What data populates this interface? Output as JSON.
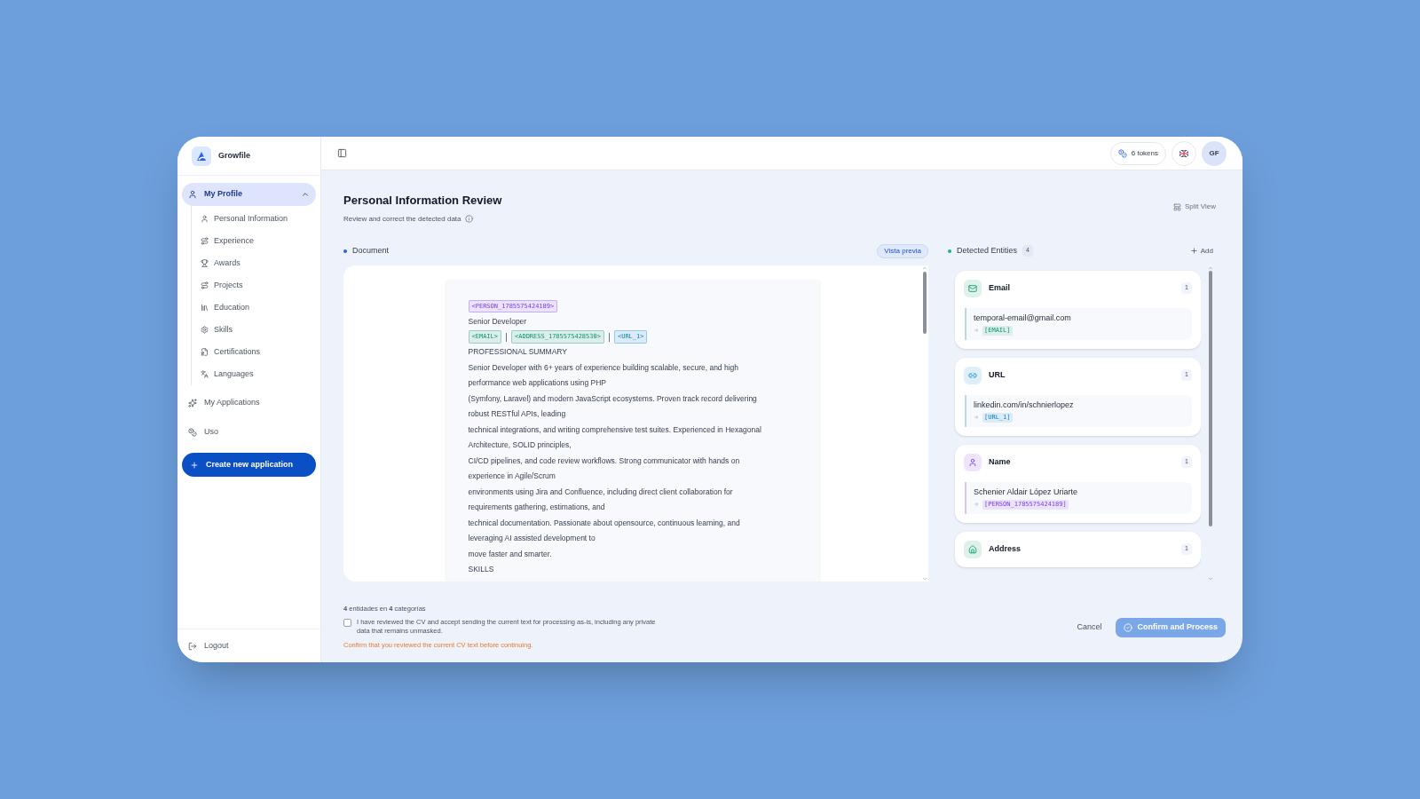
{
  "brand": {
    "name": "Growfile"
  },
  "sidebar": {
    "items": [
      {
        "label": "My Profile",
        "selected": true,
        "expanded": true,
        "children": [
          {
            "label": "Personal Information"
          },
          {
            "label": "Experience"
          },
          {
            "label": "Awards"
          },
          {
            "label": "Projects"
          },
          {
            "label": "Education"
          },
          {
            "label": "Skills"
          },
          {
            "label": "Certifications"
          },
          {
            "label": "Languages"
          }
        ]
      },
      {
        "label": "My Applications",
        "selected": false
      },
      {
        "label": "Uso",
        "selected": false
      }
    ],
    "create_button": "Create new application",
    "logout": "Logout"
  },
  "topbar": {
    "tokens": "6 tokens",
    "avatar": "GF"
  },
  "page": {
    "title": "Personal Information Review",
    "subtitle": "Review and correct the detected data",
    "split_view": "Split View"
  },
  "document": {
    "label": "Document",
    "preview_button": "Vista previa",
    "lines": [
      {
        "kind": "tags",
        "tags": [
          {
            "text": "<PERSON_1785575424189>",
            "kind": "name"
          }
        ]
      },
      {
        "kind": "text",
        "text": "Senior Developer"
      },
      {
        "kind": "tags",
        "tags": [
          {
            "text": "<EMAIL>",
            "kind": "email"
          },
          {
            "text": "<ADDRESS_1785575428530>",
            "kind": "address"
          },
          {
            "text": "<URL_1>",
            "kind": "url"
          }
        ]
      },
      {
        "kind": "text",
        "text": "PROFESSIONAL SUMMARY"
      },
      {
        "kind": "text",
        "text": "Senior Developer with 6+ years of experience building scalable, secure, and high"
      },
      {
        "kind": "text",
        "text": "performance web applications using PHP"
      },
      {
        "kind": "text",
        "text": "(Symfony, Laravel) and modern JavaScript ecosystems. Proven track record delivering"
      },
      {
        "kind": "text",
        "text": "robust RESTful APIs, leading"
      },
      {
        "kind": "text",
        "text": "technical integrations, and writing comprehensive test suites. Experienced in Hexagonal"
      },
      {
        "kind": "text",
        "text": "Architecture, SOLID principles,"
      },
      {
        "kind": "text",
        "text": "CI/CD pipelines, and code review workflows. Strong communicator with hands on"
      },
      {
        "kind": "text",
        "text": "experience in Agile/Scrum"
      },
      {
        "kind": "text",
        "text": "environments using Jira and Confluence, including direct client collaboration for"
      },
      {
        "kind": "text",
        "text": "requirements gathering, estimations, and"
      },
      {
        "kind": "text",
        "text": "technical documentation. Passionate about opensource, continuous learning, and"
      },
      {
        "kind": "text",
        "text": "leveraging AI assisted development to"
      },
      {
        "kind": "text",
        "text": "move faster and smarter."
      },
      {
        "kind": "text",
        "text": "SKILLS"
      }
    ]
  },
  "entities": {
    "label": "Detected Entities",
    "count": "4",
    "add_button": "Add",
    "groups": [
      {
        "kind": "email",
        "title": "Email",
        "count": "1",
        "value": "temporal-email@gmail.com",
        "token": "[EMAIL]"
      },
      {
        "kind": "url",
        "title": "URL",
        "count": "1",
        "value": "linkedin.com/in/schnierlopez",
        "token": "[URL_1]"
      },
      {
        "kind": "name",
        "title": "Name",
        "count": "1",
        "value": "Schenier Aldair López Uriarte",
        "token": "[PERSON_1785575424189]"
      },
      {
        "kind": "address",
        "title": "Address",
        "count": "1"
      }
    ]
  },
  "footer": {
    "summary": "**4** entidades en **4** categorías",
    "consent": {
      "label": "I have reviewed the CV and accept sending the current text for processing as-is, including any private data that remains unmasked.",
      "checked": false
    },
    "warning": "Confirm that you reviewed the current CV text before continuing.",
    "cancel": "Cancel",
    "confirm": {
      "label": "Confirm and Process",
      "disabled": true
    }
  }
}
